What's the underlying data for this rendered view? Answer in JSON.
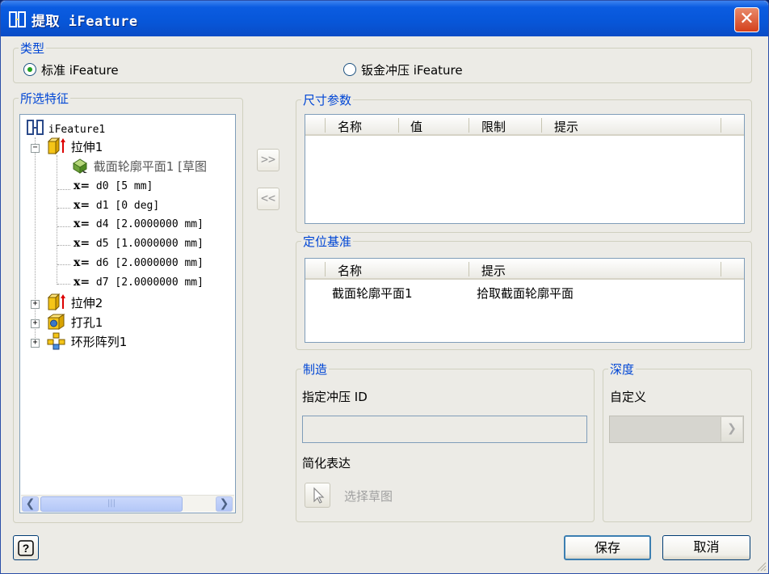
{
  "window": {
    "title": "提取 iFeature"
  },
  "type_group": {
    "legend": "类型",
    "options": [
      {
        "label": "标准 iFeature",
        "checked": true
      },
      {
        "label": "钣金冲压 iFeature",
        "checked": false
      }
    ]
  },
  "features_group": {
    "legend": "所选特征",
    "tree": {
      "root": "iFeature1",
      "nodes": [
        {
          "label": "拉伸1",
          "expanded": true,
          "icon": "extrude-icon"
        },
        {
          "label": "截面轮廓平面1 [草图",
          "icon": "sketch-plane-icon",
          "greyed": true
        },
        {
          "label": "d0 [5 mm]",
          "icon": "parameter-icon"
        },
        {
          "label": "d1 [0 deg]",
          "icon": "parameter-icon"
        },
        {
          "label": "d4 [2.0000000 mm]",
          "icon": "parameter-icon"
        },
        {
          "label": "d5 [1.0000000 mm]",
          "icon": "parameter-icon"
        },
        {
          "label": "d6 [2.0000000 mm]",
          "icon": "parameter-icon"
        },
        {
          "label": "d7 [2.0000000 mm]",
          "icon": "parameter-icon"
        },
        {
          "label": "拉伸2",
          "expanded": false,
          "icon": "extrude-icon"
        },
        {
          "label": "打孔1",
          "expanded": false,
          "icon": "hole-icon"
        },
        {
          "label": "环形阵列1",
          "expanded": false,
          "icon": "circular-pattern-icon"
        }
      ],
      "param_prefix": "x="
    },
    "scrollbar_grip": "|||"
  },
  "move_buttons": {
    "add": ">>",
    "remove": "<<"
  },
  "size_params": {
    "legend": "尺寸参数",
    "columns": [
      "名称",
      "值",
      "限制",
      "提示"
    ],
    "rows": []
  },
  "position_basis": {
    "legend": "定位基准",
    "columns": [
      "名称",
      "提示"
    ],
    "rows": [
      {
        "name": "截面轮廓平面1",
        "hint": "拾取截面轮廓平面"
      }
    ]
  },
  "manufacture": {
    "legend": "制造",
    "punch_id_label": "指定冲压 ID",
    "punch_id_value": "",
    "simplified_label": "简化表达",
    "select_sketch": "选择草图"
  },
  "depth": {
    "legend": "深度",
    "label": "自定义",
    "value": ""
  },
  "footer": {
    "help": "?",
    "save": "保存",
    "cancel": "取消"
  },
  "colors": {
    "titlebar": "#0756d8",
    "legend_text": "#0046d5",
    "dialog_bg": "#ecebe6"
  }
}
